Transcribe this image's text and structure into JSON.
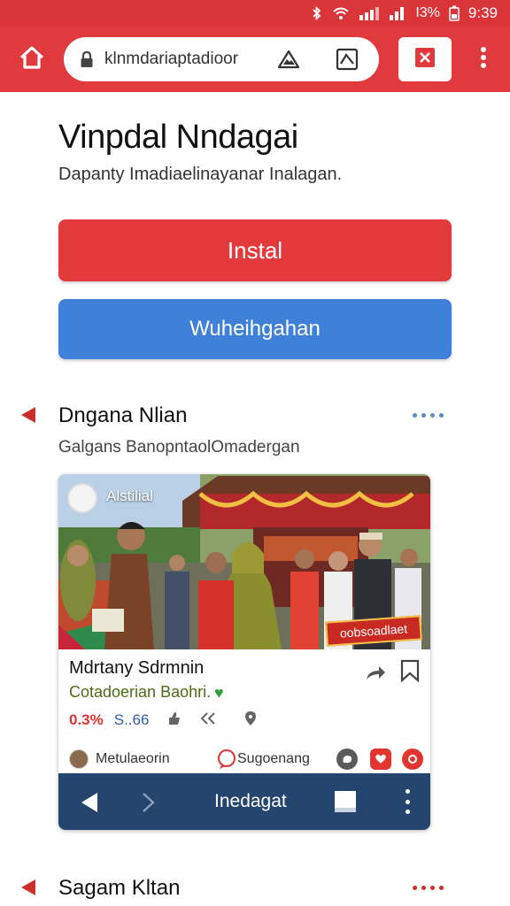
{
  "status_bar": {
    "battery": "I3%",
    "time": "9:39"
  },
  "browser": {
    "url": "klnmdariaptadioor",
    "icons": [
      "home-icon",
      "lock-icon",
      "warning-triangle-icon",
      "image-icon",
      "close-tab-icon",
      "more-vertical-icon"
    ]
  },
  "hero": {
    "title": "Vinpdal Nndagai",
    "subtitle": "Dapanty Imadiaelinayanar Inalagan.",
    "primary_button": "Instal",
    "secondary_button": "Wuheihgahan"
  },
  "section1": {
    "title": "Dngana Nlian",
    "subtitle": "Galgans BanopntaolOmadergan"
  },
  "card": {
    "image_caption": "Alstilial",
    "image_tag": "oobsoadlaet",
    "title": "Mdrtany Sdrmnin",
    "description": "Cotadoerian Baohri.",
    "heart": "♥",
    "stat_percent": "0.3%",
    "stat_value": "S..66",
    "author": "Metulaeorin",
    "suggest_label": "Sugoenang",
    "nav_label": "Inedagat"
  },
  "section2": {
    "title": "Sagam Kltan"
  },
  "colors": {
    "brand_red": "#e03a3e",
    "button_blue": "#3f80d8",
    "nav_navy": "#24456e",
    "accent_green": "#4a6d12"
  }
}
